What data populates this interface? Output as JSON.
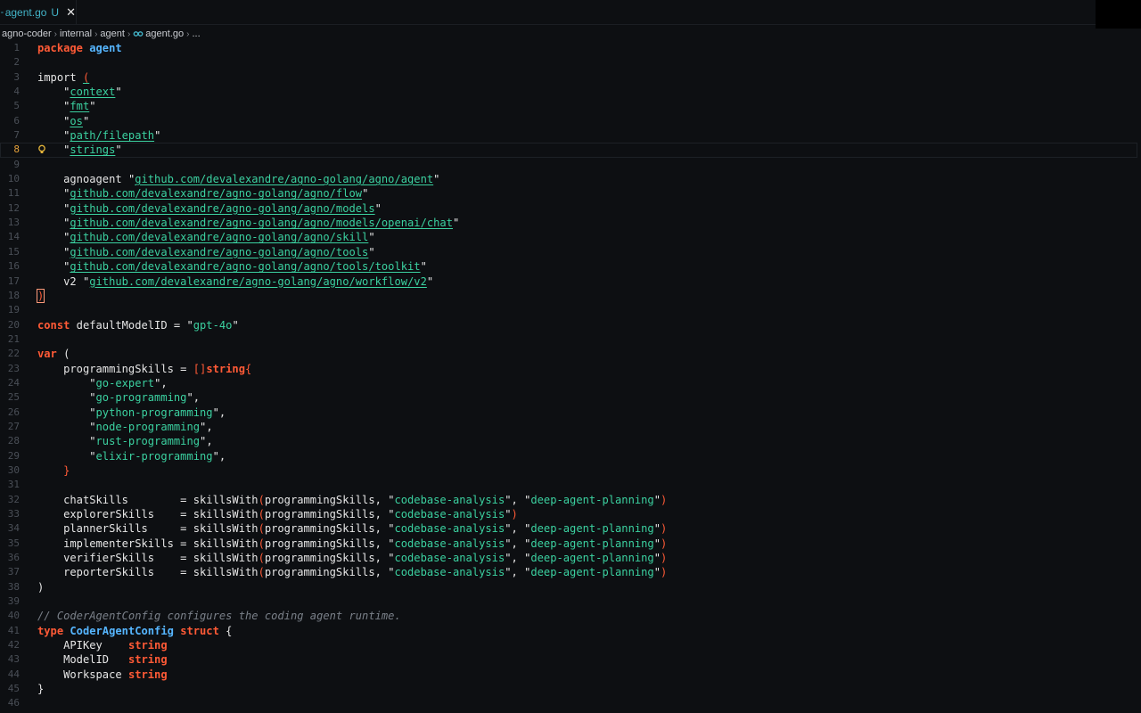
{
  "tab": {
    "filename": "agent.go",
    "status": "U",
    "close_glyph": "✕",
    "icon": "go-file-icon",
    "accent": "#42b3c7"
  },
  "breadcrumb": {
    "items": [
      "agno-coder",
      "internal",
      "agent",
      "agent.go",
      "..."
    ],
    "separator": "›"
  },
  "editor": {
    "current_line": 8,
    "lines": [
      {
        "n": "1",
        "tokens": [
          [
            "kw",
            "package"
          ],
          [
            "id",
            " "
          ],
          [
            "ty",
            "agent"
          ]
        ]
      },
      {
        "n": "2",
        "tokens": []
      },
      {
        "n": "3",
        "tokens": [
          [
            "id",
            "import "
          ],
          [
            "brk",
            "("
          ]
        ]
      },
      {
        "n": "4",
        "tokens": [
          [
            "id",
            "    "
          ],
          [
            "q",
            "\""
          ],
          [
            "stru",
            "context"
          ],
          [
            "q",
            "\""
          ]
        ]
      },
      {
        "n": "5",
        "tokens": [
          [
            "id",
            "    "
          ],
          [
            "q",
            "\""
          ],
          [
            "stru",
            "fmt"
          ],
          [
            "q",
            "\""
          ]
        ]
      },
      {
        "n": "6",
        "tokens": [
          [
            "id",
            "    "
          ],
          [
            "q",
            "\""
          ],
          [
            "stru",
            "os"
          ],
          [
            "q",
            "\""
          ]
        ]
      },
      {
        "n": "7",
        "tokens": [
          [
            "id",
            "    "
          ],
          [
            "q",
            "\""
          ],
          [
            "stru",
            "path/filepath"
          ],
          [
            "q",
            "\""
          ]
        ]
      },
      {
        "n": "8",
        "tokens": [
          [
            "id",
            "    "
          ],
          [
            "q",
            "\""
          ],
          [
            "stru",
            "strings"
          ],
          [
            "q",
            "\""
          ]
        ]
      },
      {
        "n": "9",
        "tokens": []
      },
      {
        "n": "10",
        "tokens": [
          [
            "id",
            "    agnoagent "
          ],
          [
            "q",
            "\""
          ],
          [
            "stru",
            "github.com/devalexandre/agno-golang/agno/agent"
          ],
          [
            "q",
            "\""
          ]
        ]
      },
      {
        "n": "11",
        "tokens": [
          [
            "id",
            "    "
          ],
          [
            "q",
            "\""
          ],
          [
            "stru",
            "github.com/devalexandre/agno-golang/agno/flow"
          ],
          [
            "q",
            "\""
          ]
        ]
      },
      {
        "n": "12",
        "tokens": [
          [
            "id",
            "    "
          ],
          [
            "q",
            "\""
          ],
          [
            "stru",
            "github.com/devalexandre/agno-golang/agno/models"
          ],
          [
            "q",
            "\""
          ]
        ]
      },
      {
        "n": "13",
        "tokens": [
          [
            "id",
            "    "
          ],
          [
            "q",
            "\""
          ],
          [
            "stru",
            "github.com/devalexandre/agno-golang/agno/models/openai/chat"
          ],
          [
            "q",
            "\""
          ]
        ]
      },
      {
        "n": "14",
        "tokens": [
          [
            "id",
            "    "
          ],
          [
            "q",
            "\""
          ],
          [
            "stru",
            "github.com/devalexandre/agno-golang/agno/skill"
          ],
          [
            "q",
            "\""
          ]
        ]
      },
      {
        "n": "15",
        "tokens": [
          [
            "id",
            "    "
          ],
          [
            "q",
            "\""
          ],
          [
            "stru",
            "github.com/devalexandre/agno-golang/agno/tools"
          ],
          [
            "q",
            "\""
          ]
        ]
      },
      {
        "n": "16",
        "tokens": [
          [
            "id",
            "    "
          ],
          [
            "q",
            "\""
          ],
          [
            "stru",
            "github.com/devalexandre/agno-golang/agno/tools/toolkit"
          ],
          [
            "q",
            "\""
          ]
        ]
      },
      {
        "n": "17",
        "tokens": [
          [
            "id",
            "    v2 "
          ],
          [
            "q",
            "\""
          ],
          [
            "stru",
            "github.com/devalexandre/agno-golang/agno/workflow/v2"
          ],
          [
            "q",
            "\""
          ]
        ]
      },
      {
        "n": "18",
        "tokens": [
          [
            "brkbox",
            ")"
          ]
        ]
      },
      {
        "n": "19",
        "tokens": []
      },
      {
        "n": "20",
        "tokens": [
          [
            "kw",
            "const"
          ],
          [
            "id",
            " defaultModelID = "
          ],
          [
            "q",
            "\""
          ],
          [
            "str",
            "gpt-4o"
          ],
          [
            "q",
            "\""
          ]
        ]
      },
      {
        "n": "21",
        "tokens": []
      },
      {
        "n": "22",
        "tokens": [
          [
            "kw",
            "var"
          ],
          [
            "id",
            " ("
          ]
        ]
      },
      {
        "n": "23",
        "tokens": [
          [
            "id",
            "    programmingSkills = "
          ],
          [
            "pn",
            "[]"
          ],
          [
            "kw",
            "string"
          ],
          [
            "pn",
            "{"
          ]
        ]
      },
      {
        "n": "24",
        "tokens": [
          [
            "id",
            "        "
          ],
          [
            "q",
            "\""
          ],
          [
            "str",
            "go-expert"
          ],
          [
            "q",
            "\""
          ],
          [
            "id",
            ","
          ]
        ]
      },
      {
        "n": "25",
        "tokens": [
          [
            "id",
            "        "
          ],
          [
            "q",
            "\""
          ],
          [
            "str",
            "go-programming"
          ],
          [
            "q",
            "\""
          ],
          [
            "id",
            ","
          ]
        ]
      },
      {
        "n": "26",
        "tokens": [
          [
            "id",
            "        "
          ],
          [
            "q",
            "\""
          ],
          [
            "str",
            "python-programming"
          ],
          [
            "q",
            "\""
          ],
          [
            "id",
            ","
          ]
        ]
      },
      {
        "n": "27",
        "tokens": [
          [
            "id",
            "        "
          ],
          [
            "q",
            "\""
          ],
          [
            "str",
            "node-programming"
          ],
          [
            "q",
            "\""
          ],
          [
            "id",
            ","
          ]
        ]
      },
      {
        "n": "28",
        "tokens": [
          [
            "id",
            "        "
          ],
          [
            "q",
            "\""
          ],
          [
            "str",
            "rust-programming"
          ],
          [
            "q",
            "\""
          ],
          [
            "id",
            ","
          ]
        ]
      },
      {
        "n": "29",
        "tokens": [
          [
            "id",
            "        "
          ],
          [
            "q",
            "\""
          ],
          [
            "str",
            "elixir-programming"
          ],
          [
            "q",
            "\""
          ],
          [
            "id",
            ","
          ]
        ]
      },
      {
        "n": "30",
        "tokens": [
          [
            "id",
            "    "
          ],
          [
            "pn",
            "}"
          ]
        ]
      },
      {
        "n": "31",
        "tokens": []
      },
      {
        "n": "32",
        "tokens": [
          [
            "id",
            "    chatSkills        = "
          ],
          [
            "fn",
            "skillsWith"
          ],
          [
            "pn",
            "("
          ],
          [
            "id",
            "programmingSkills, "
          ],
          [
            "q",
            "\""
          ],
          [
            "str",
            "codebase-analysis"
          ],
          [
            "q",
            "\""
          ],
          [
            "id",
            ", "
          ],
          [
            "q",
            "\""
          ],
          [
            "str",
            "deep-agent-planning"
          ],
          [
            "q",
            "\""
          ],
          [
            "pn",
            ")"
          ]
        ]
      },
      {
        "n": "33",
        "tokens": [
          [
            "id",
            "    explorerSkills    = "
          ],
          [
            "fn",
            "skillsWith"
          ],
          [
            "pn",
            "("
          ],
          [
            "id",
            "programmingSkills, "
          ],
          [
            "q",
            "\""
          ],
          [
            "str",
            "codebase-analysis"
          ],
          [
            "q",
            "\""
          ],
          [
            "pn",
            ")"
          ]
        ]
      },
      {
        "n": "34",
        "tokens": [
          [
            "id",
            "    plannerSkills     = "
          ],
          [
            "fn",
            "skillsWith"
          ],
          [
            "pn",
            "("
          ],
          [
            "id",
            "programmingSkills, "
          ],
          [
            "q",
            "\""
          ],
          [
            "str",
            "codebase-analysis"
          ],
          [
            "q",
            "\""
          ],
          [
            "id",
            ", "
          ],
          [
            "q",
            "\""
          ],
          [
            "str",
            "deep-agent-planning"
          ],
          [
            "q",
            "\""
          ],
          [
            "pn",
            ")"
          ]
        ]
      },
      {
        "n": "35",
        "tokens": [
          [
            "id",
            "    implementerSkills = "
          ],
          [
            "fn",
            "skillsWith"
          ],
          [
            "pn",
            "("
          ],
          [
            "id",
            "programmingSkills, "
          ],
          [
            "q",
            "\""
          ],
          [
            "str",
            "codebase-analysis"
          ],
          [
            "q",
            "\""
          ],
          [
            "id",
            ", "
          ],
          [
            "q",
            "\""
          ],
          [
            "str",
            "deep-agent-planning"
          ],
          [
            "q",
            "\""
          ],
          [
            "pn",
            ")"
          ]
        ]
      },
      {
        "n": "36",
        "tokens": [
          [
            "id",
            "    verifierSkills    = "
          ],
          [
            "fn",
            "skillsWith"
          ],
          [
            "pn",
            "("
          ],
          [
            "id",
            "programmingSkills, "
          ],
          [
            "q",
            "\""
          ],
          [
            "str",
            "codebase-analysis"
          ],
          [
            "q",
            "\""
          ],
          [
            "id",
            ", "
          ],
          [
            "q",
            "\""
          ],
          [
            "str",
            "deep-agent-planning"
          ],
          [
            "q",
            "\""
          ],
          [
            "pn",
            ")"
          ]
        ]
      },
      {
        "n": "37",
        "tokens": [
          [
            "id",
            "    reporterSkills    = "
          ],
          [
            "fn",
            "skillsWith"
          ],
          [
            "pn",
            "("
          ],
          [
            "id",
            "programmingSkills, "
          ],
          [
            "q",
            "\""
          ],
          [
            "str",
            "codebase-analysis"
          ],
          [
            "q",
            "\""
          ],
          [
            "id",
            ", "
          ],
          [
            "q",
            "\""
          ],
          [
            "str",
            "deep-agent-planning"
          ],
          [
            "q",
            "\""
          ],
          [
            "pn",
            ")"
          ]
        ]
      },
      {
        "n": "38",
        "tokens": [
          [
            "id",
            ")"
          ]
        ]
      },
      {
        "n": "39",
        "tokens": []
      },
      {
        "n": "40",
        "tokens": [
          [
            "cm",
            "// CoderAgentConfig configures the coding agent runtime."
          ]
        ]
      },
      {
        "n": "41",
        "tokens": [
          [
            "kw",
            "type"
          ],
          [
            "id",
            " "
          ],
          [
            "ty",
            "CoderAgentConfig"
          ],
          [
            "id",
            " "
          ],
          [
            "kw",
            "struct"
          ],
          [
            "id",
            " {"
          ]
        ]
      },
      {
        "n": "42",
        "tokens": [
          [
            "id",
            "    APIKey    "
          ],
          [
            "kw",
            "string"
          ]
        ]
      },
      {
        "n": "43",
        "tokens": [
          [
            "id",
            "    ModelID   "
          ],
          [
            "kw",
            "string"
          ]
        ]
      },
      {
        "n": "44",
        "tokens": [
          [
            "id",
            "    Workspace "
          ],
          [
            "kw",
            "string"
          ]
        ]
      },
      {
        "n": "45",
        "tokens": [
          [
            "id",
            "}"
          ]
        ]
      },
      {
        "n": "46",
        "tokens": []
      }
    ]
  },
  "colors": {
    "background": "#0d0f12",
    "keyword": "#ff5a36",
    "type": "#56b6ff",
    "string": "#3bd1a0",
    "comment": "#7a8089",
    "lightbulb": "#e4b43a"
  },
  "icons": {
    "lightbulb": "lightbulb-icon"
  }
}
